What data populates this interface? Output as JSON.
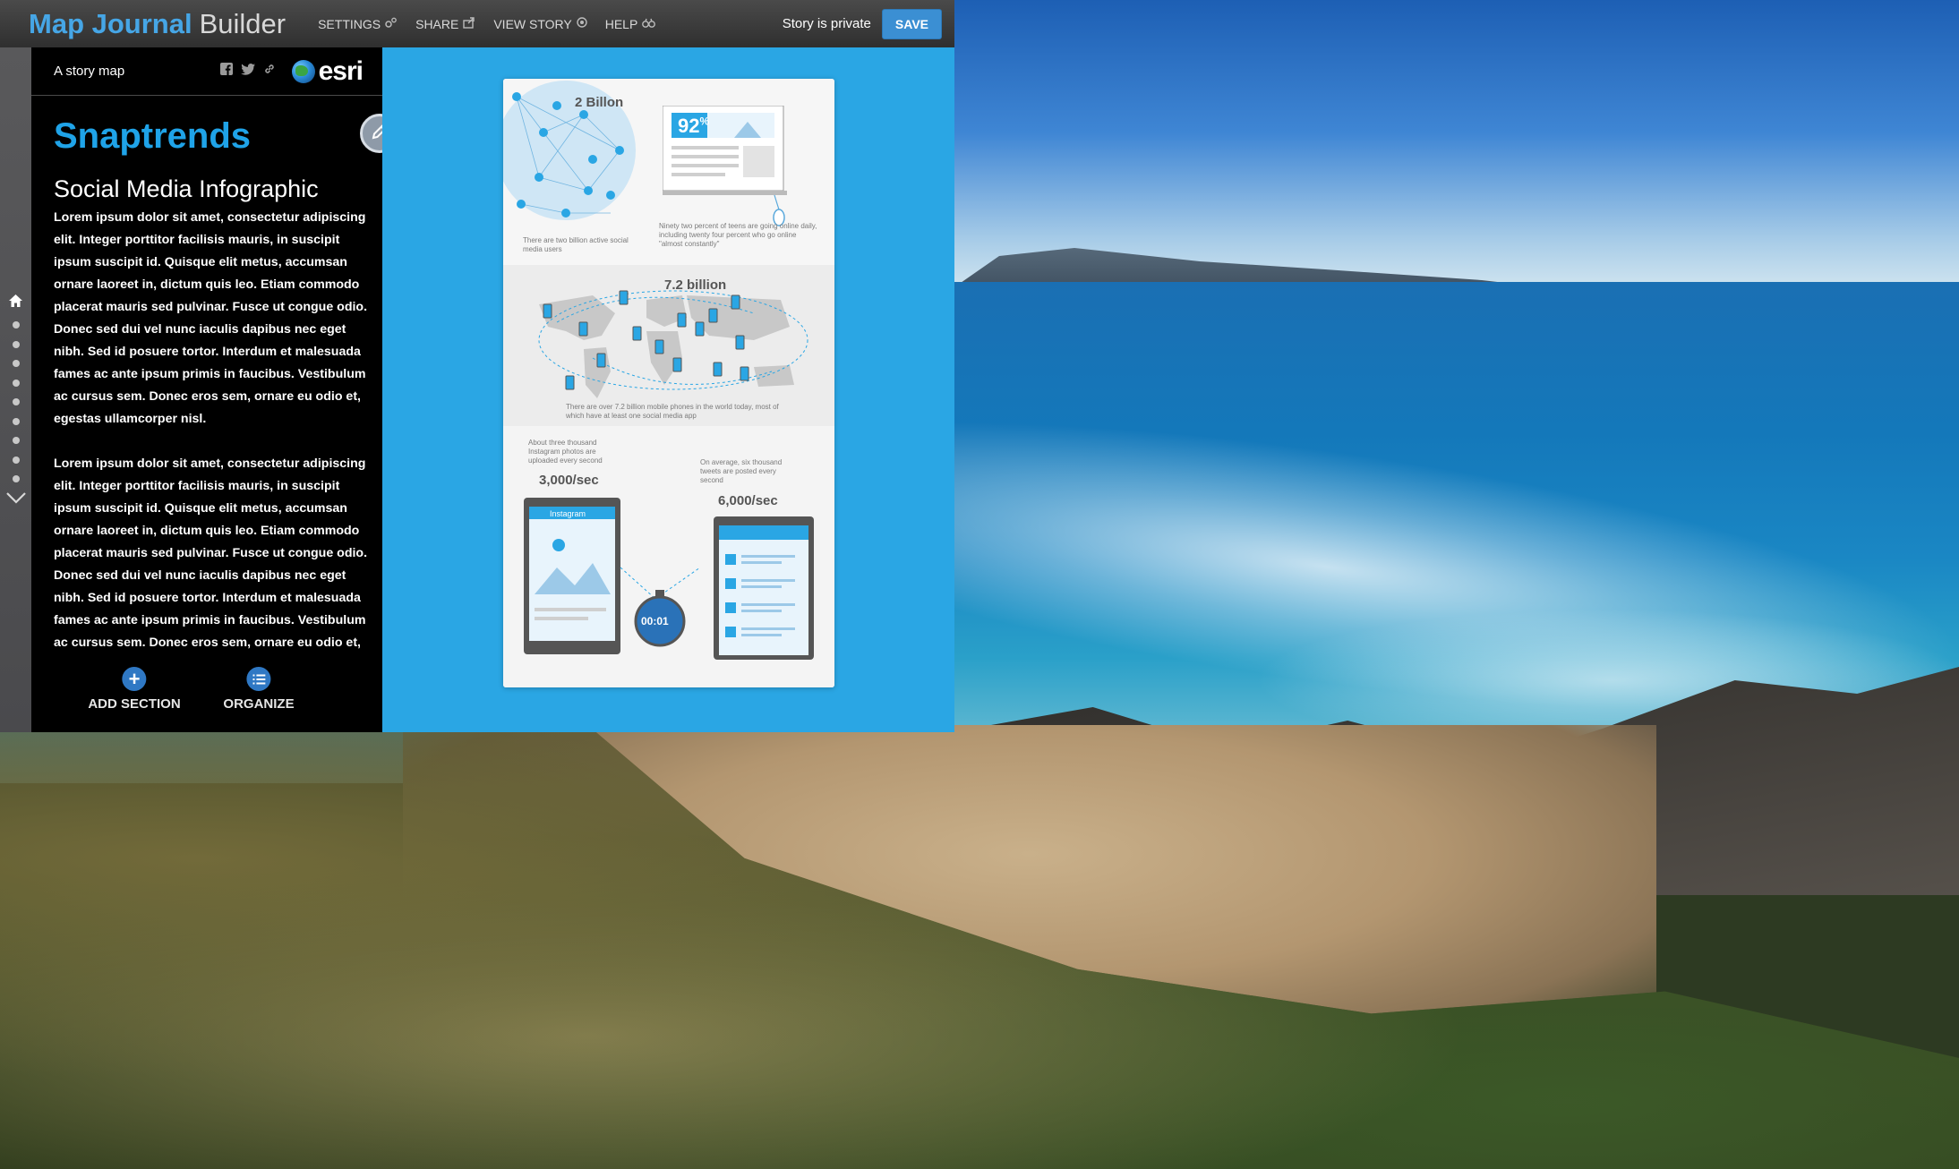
{
  "builder": {
    "title_primary": "Map Journal",
    "title_secondary": "Builder",
    "nav": [
      {
        "label": "SETTINGS",
        "icon": "gears-icon"
      },
      {
        "label": "SHARE",
        "icon": "share-icon"
      },
      {
        "label": "VIEW STORY",
        "icon": "eye-icon"
      },
      {
        "label": "HELP",
        "icon": "binoculars-icon"
      }
    ],
    "status": "Story is private",
    "save_label": "SAVE"
  },
  "panel": {
    "tagline": "A story map",
    "logo_text": "esri",
    "story_title": "Snaptrends",
    "section_heading": "Social Media Infographic",
    "paragraphs": [
      "Lorem ipsum dolor sit amet, consectetur adipiscing elit. Integer porttitor facilisis mauris, in suscipit ipsum suscipit id. Quisque elit metus, accumsan ornare laoreet in, dictum quis leo. Etiam commodo placerat mauris sed pulvinar. Fusce ut congue odio. Donec sed dui vel nunc iaculis dapibus nec eget nibh. Sed id posuere tortor. Interdum et malesuada fames ac ante ipsum primis in faucibus. Vestibulum ac cursus sem. Donec eros sem, ornare eu odio et, egestas ullamcorper nisl.",
      "Lorem ipsum dolor sit amet, consectetur adipiscing elit. Integer porttitor facilisis mauris, in suscipit ipsum suscipit id. Quisque elit metus, accumsan ornare laoreet in, dictum quis leo. Etiam commodo placerat mauris sed pulvinar. Fusce ut congue odio. Donec sed dui vel nunc iaculis dapibus nec eget nibh. Sed id posuere tortor. Interdum et malesuada fames ac ante ipsum primis in faucibus. Vestibulum ac cursus sem. Donec eros sem, ornare eu odio et,"
    ],
    "actions": {
      "add_section": "ADD SECTION",
      "organize": "ORGANIZE"
    },
    "nav_dot_count": 9
  },
  "infographic": {
    "users_number": "2 Billon",
    "users_caption": "There are two billion active social media users",
    "teens_number": "92",
    "teens_pct": "%",
    "teens_caption": "Ninety two percent of teens are going online daily, including twenty four percent who go online \"almost constantly\"",
    "phones_number": "7.2 billion",
    "phones_caption": "There are over 7.2 billion mobile phones in the world today, most of which have at least one social media app",
    "instagram_caption": "About three thousand Instagram photos are uploaded every second",
    "instagram_rate": "3,000/sec",
    "instagram_label": "Instagram",
    "tweets_caption": "On average, six thousand tweets are posted every second",
    "tweets_rate": "6,000/sec",
    "timer": "00:01"
  },
  "colors": {
    "accent": "#1fa3e8",
    "stage": "#2aa6e4",
    "save": "#3b8fd3",
    "action": "#2f78c4"
  }
}
